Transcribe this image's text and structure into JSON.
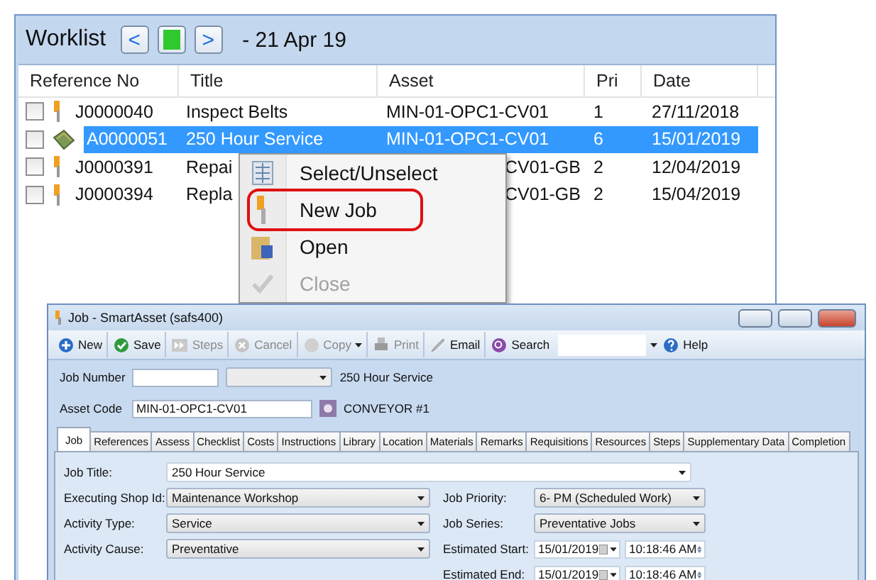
{
  "worklist": {
    "title": "Worklist",
    "nav_buttons": [
      {
        "kind": "prev",
        "label": "<"
      },
      {
        "kind": "today"
      },
      {
        "kind": "next",
        "label": ">"
      }
    ],
    "date_range": "- 21 Apr 19",
    "columns": [
      "Reference No",
      "Title",
      "Asset",
      "Pri",
      "Date"
    ],
    "rows": [
      {
        "kind": "job",
        "checked": false,
        "selected": false,
        "covered": false,
        "reference": "J0000040",
        "title": "Inspect Belts",
        "asset": "MIN-01-OPC1-CV01",
        "pri": "1",
        "date": "27/11/2018"
      },
      {
        "kind": "activity",
        "checked": false,
        "selected": true,
        "covered": false,
        "reference": "A0000051",
        "title": "250 Hour Service",
        "asset": "MIN-01-OPC1-CV01",
        "pri": "6",
        "date": "15/01/2019"
      },
      {
        "kind": "job",
        "checked": false,
        "selected": false,
        "covered": true,
        "reference": "J0000391",
        "title": "Repai",
        "asset": "CV01-GB",
        "pri": "2",
        "date": "12/04/2019"
      },
      {
        "kind": "job",
        "checked": false,
        "selected": false,
        "covered": true,
        "reference": "J0000394",
        "title": "Repla",
        "asset": "CV01-GB",
        "pri": "2",
        "date": "15/04/2019"
      }
    ]
  },
  "context_menu": {
    "items": [
      {
        "kind": "select",
        "label": "Select/Unselect",
        "highlighted": false,
        "disabled": false
      },
      {
        "kind": "new",
        "label": "New Job",
        "highlighted": true,
        "disabled": false
      },
      {
        "kind": "open",
        "label": "Open",
        "highlighted": false,
        "disabled": false
      },
      {
        "kind": "close",
        "label": "Close",
        "highlighted": false,
        "disabled": true
      }
    ]
  },
  "job_window": {
    "title": "Job - SmartAsset (safs400)",
    "toolbar": [
      {
        "kind": "new",
        "label": "New",
        "disabled": false
      },
      {
        "kind": "save",
        "label": "Save",
        "disabled": false
      },
      {
        "kind": "steps",
        "label": "Steps",
        "disabled": true
      },
      {
        "kind": "cancel",
        "label": "Cancel",
        "disabled": true
      },
      {
        "kind": "copy",
        "label": "Copy",
        "disabled": true
      },
      {
        "kind": "print",
        "label": "Print",
        "disabled": true
      },
      {
        "kind": "email",
        "label": "Email",
        "disabled": false
      },
      {
        "kind": "search",
        "label": "Search",
        "disabled": false
      },
      {
        "kind": "help",
        "label": "Help",
        "disabled": false
      }
    ],
    "job_number": {
      "label": "Job Number",
      "caption": "250 Hour Service"
    },
    "asset_code": {
      "label": "Asset Code",
      "value": "MIN-01-OPC1-CV01",
      "description": "CONVEYOR #1"
    },
    "tabs": [
      {
        "label": "Job",
        "selected": true
      },
      {
        "label": "References",
        "selected": false
      },
      {
        "label": "Assess",
        "selected": false
      },
      {
        "label": "Checklist",
        "selected": false
      },
      {
        "label": "Costs",
        "selected": false
      },
      {
        "label": "Instructions",
        "selected": false
      },
      {
        "label": "Library",
        "selected": false
      },
      {
        "label": "Location",
        "selected": false
      },
      {
        "label": "Materials",
        "selected": false
      },
      {
        "label": "Remarks",
        "selected": false
      },
      {
        "label": "Requisitions",
        "selected": false
      },
      {
        "label": "Resources",
        "selected": false
      },
      {
        "label": "Steps",
        "selected": false
      },
      {
        "label": "Supplementary Data",
        "selected": false
      },
      {
        "label": "Completion",
        "selected": false
      }
    ],
    "job_title": {
      "label": "Job Title:",
      "value": "250 Hour Service"
    },
    "left_fields": [
      {
        "label": "Executing Shop Id:",
        "value": "Maintenance Workshop"
      },
      {
        "label": "Activity Type:",
        "value": "Service"
      },
      {
        "label": "Activity Cause:",
        "value": "Preventative"
      }
    ],
    "right_fields": [
      {
        "kind": "combo",
        "label": "Job Priority:",
        "value": "6- PM (Scheduled Work)"
      },
      {
        "kind": "combo",
        "label": "Job Series:",
        "value": "Preventative Jobs"
      },
      {
        "kind": "datetime",
        "label": "Estimated Start:",
        "date": "15/01/2019",
        "time": "10:18:46 AM"
      },
      {
        "kind": "datetime",
        "label": "Estimated End:",
        "date": "15/01/2019",
        "time": "10:18:46 AM"
      }
    ]
  }
}
